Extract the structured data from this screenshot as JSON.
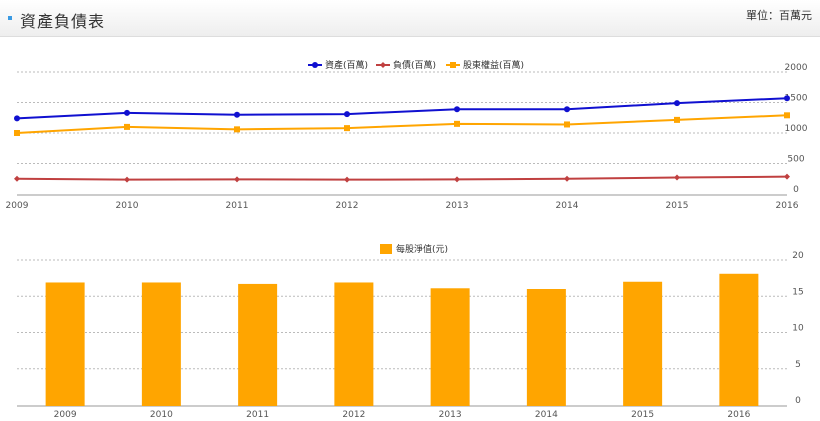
{
  "header": {
    "title": "資產負債表",
    "unit_label": "單位：百萬元"
  },
  "colors": {
    "assets": "#1010d0",
    "liabilities": "#c04040",
    "equity": "#ffa500",
    "bar": "#ffa500",
    "grid": "#bbbbbb",
    "axis": "#999999"
  },
  "chart_data": [
    {
      "type": "line",
      "x": [
        "2009",
        "2010",
        "2011",
        "2012",
        "2013",
        "2014",
        "2015",
        "2016"
      ],
      "series": [
        {
          "name": "資產(百萬)",
          "values": [
            1240,
            1330,
            1300,
            1310,
            1390,
            1390,
            1490,
            1570
          ]
        },
        {
          "name": "負債(百萬)",
          "values": [
            250,
            235,
            240,
            235,
            240,
            250,
            270,
            285
          ]
        },
        {
          "name": "股東權益(百萬)",
          "values": [
            1000,
            1100,
            1060,
            1080,
            1150,
            1140,
            1215,
            1290
          ]
        }
      ],
      "yticks": [
        "0",
        "500",
        "1000",
        "1500",
        "2000"
      ],
      "ylim": [
        0,
        2000
      ],
      "grid": true,
      "legend": "top-center"
    },
    {
      "type": "bar",
      "categories": [
        "2009",
        "2010",
        "2011",
        "2012",
        "2013",
        "2014",
        "2015",
        "2016"
      ],
      "series": [
        {
          "name": "每股淨值(元)",
          "values": [
            16.9,
            16.9,
            16.7,
            16.9,
            16.1,
            16.0,
            17.0,
            18.1
          ]
        }
      ],
      "yticks": [
        "0",
        "5",
        "10",
        "15",
        "20"
      ],
      "ylim": [
        0,
        20
      ],
      "grid": true,
      "legend": "top-center"
    }
  ]
}
